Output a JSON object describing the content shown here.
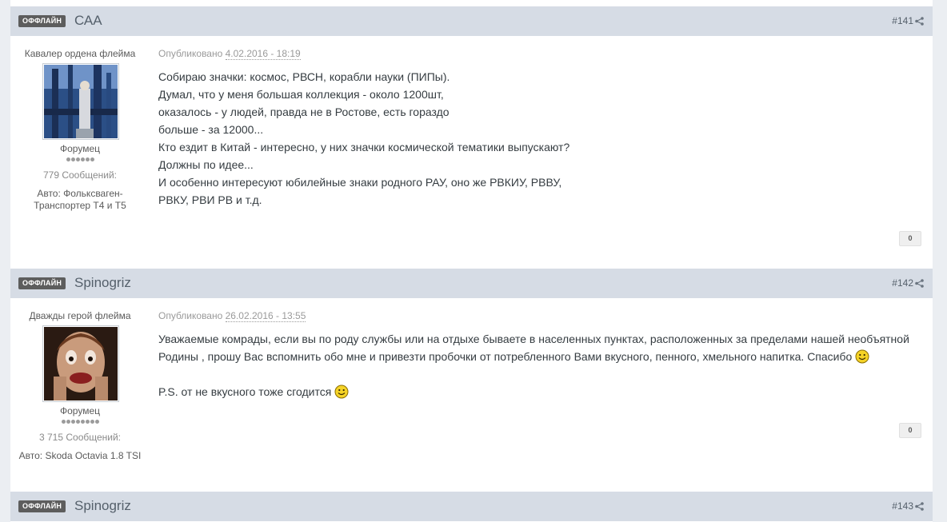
{
  "posts": [
    {
      "badge": "ОФФЛАЙН",
      "author": "САА",
      "number": "#141",
      "rank_title": "Кавалер ордена флейма",
      "group": "Форумец",
      "pips": 6,
      "post_count": "779 Сообщений:",
      "car_line1": "Авто: Фольксваген-",
      "car_line2": "Транспортер Т4 и Т5",
      "published_label": "Опубликовано",
      "published_date": "4.02.2016 - 18:19",
      "lines": [
        "Собираю значки: космос, РВСН, корабли науки (ПИПы).",
        "Думал, что у меня большая коллекция - около 1200шт,",
        "оказалось - у людей, правда не в Ростове, есть гораздо",
        "больше - за 12000...",
        "Кто ездит в Китай - интересно, у них значки космической тематики выпускают?",
        "Должны по идее...",
        "И особенно интересуют юбилейные знаки родного РАУ, оно же РВКИУ, РВВУ,",
        "РВКУ, РВИ РВ и т.д."
      ],
      "reputation": "0"
    },
    {
      "badge": "ОФФЛАЙН",
      "author": "Spinogriz",
      "number": "#142",
      "rank_title": "Дважды герой флейма",
      "group": "Форумец",
      "pips": 8,
      "post_count": "3 715 Сообщений:",
      "car_line1": "Авто: Skoda Octavia 1.8 TSI",
      "published_label": "Опубликовано",
      "published_date": "26.02.2016 - 13:55",
      "para1_line1": "Уважаемые комрады, если вы по роду службы или на отдыхе бываете в населенных пунктах, расположенных за пределами нашей необъятной",
      "para1_line2": "Родины , прошу Вас вспомнить обо мне и привезти пробочки от потребленного Вами вкусного, пенного, хмельного напитка. Спасибо",
      "para2": "P.S. от не вкусного тоже сгодится",
      "reputation": "0"
    },
    {
      "badge": "ОФФЛАЙН",
      "author": "Spinogriz",
      "number": "#143"
    }
  ],
  "icons": {
    "share": "share-icon",
    "smile": "smile-icon"
  }
}
